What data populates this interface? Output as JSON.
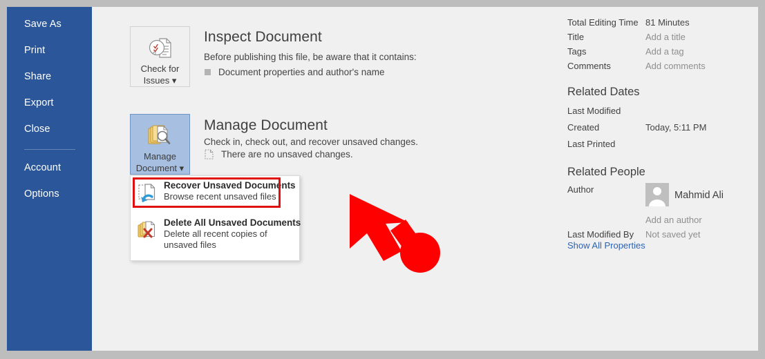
{
  "theme": {
    "sidebar_bg": "#2b579a",
    "page_bg": "#f0f0f0",
    "outer_bg": "#bdbdbd",
    "selected_button_bg": "#a7bfe0",
    "highlight_red": "#e01010",
    "link_blue": "#2e62ae"
  },
  "sidebar": {
    "items": [
      {
        "label": "Save As",
        "name": "sidebar-item-save-as"
      },
      {
        "label": "Print",
        "name": "sidebar-item-print"
      },
      {
        "label": "Share",
        "name": "sidebar-item-share"
      },
      {
        "label": "Export",
        "name": "sidebar-item-export"
      },
      {
        "label": "Close",
        "name": "sidebar-item-close"
      },
      {
        "label": "Account",
        "name": "sidebar-item-account"
      },
      {
        "label": "Options",
        "name": "sidebar-item-options"
      }
    ]
  },
  "main": {
    "inspect": {
      "button_label_line1": "Check for",
      "button_label_line2": "Issues",
      "button_icon": "check-for-issues-icon",
      "title": "Inspect Document",
      "subtitle": "Before publishing this file, be aware that it contains:",
      "bullet": "Document properties and author's name"
    },
    "manage": {
      "button_label_line1": "Manage",
      "button_label_line2": "Document",
      "button_icon": "manage-document-icon",
      "title": "Manage Document",
      "subtitle": "Check in, check out, and recover unsaved changes.",
      "bullet": "There are no unsaved changes."
    },
    "menu": {
      "items": [
        {
          "title": "Recover Unsaved Documents",
          "desc": "Browse recent unsaved files",
          "icon": "recover-unsaved-documents-icon",
          "highlighted": true
        },
        {
          "title": "Delete All Unsaved Documents",
          "desc_line1": "Delete all recent copies of",
          "desc_line2": "unsaved files",
          "icon": "delete-all-unsaved-documents-icon",
          "highlighted": false
        }
      ]
    },
    "annotation": {
      "arrow": "red-pointer-arrow"
    }
  },
  "properties": {
    "rows_top": [
      {
        "label": "Total Editing Time",
        "value": "81 Minutes",
        "placeholder": false
      },
      {
        "label": "Title",
        "value": "Add a title",
        "placeholder": true
      },
      {
        "label": "Tags",
        "value": "Add a tag",
        "placeholder": true
      },
      {
        "label": "Comments",
        "value": "Add comments",
        "placeholder": true
      }
    ],
    "related_dates_heading": "Related Dates",
    "rows_dates": [
      {
        "label": "Last Modified",
        "value": "",
        "placeholder": false
      },
      {
        "label": "Created",
        "value": "Today, 5:11 PM",
        "placeholder": false
      },
      {
        "label": "Last Printed",
        "value": "",
        "placeholder": false
      }
    ],
    "related_people_heading": "Related People",
    "author_label": "Author",
    "author_name": "Mahmid Ali",
    "add_author": "Add an author",
    "last_modified_by_label": "Last Modified By",
    "last_modified_by_value": "Not saved yet",
    "show_all_properties": "Show All Properties"
  }
}
